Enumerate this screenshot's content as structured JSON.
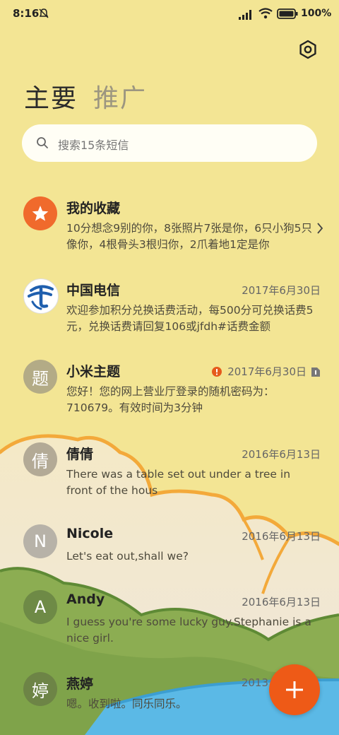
{
  "status_bar": {
    "time": "8:16",
    "battery": "100%"
  },
  "tabs": [
    {
      "label": "主要"
    },
    {
      "label": "推广"
    }
  ],
  "search": {
    "placeholder": "搜索15条短信"
  },
  "conversations": [
    {
      "name": "我的收藏",
      "date": "",
      "preview": "10分想念9别的你，8张照片7张是你，6只小狗5只像你，4根骨头3根归你，2爪着地1定是你",
      "avatar": "star-icon",
      "avatar_color": "#f06a2c"
    },
    {
      "name": "中国电信",
      "date": "2017年6月30日",
      "preview": "欢迎参加积分兑换话费活动，每500分可兑换话费5元，兑换话费请回复106或jfdh#话费金额",
      "avatar": "china-telecom-logo",
      "avatar_color": "#ffffff"
    },
    {
      "name": "小米主题",
      "date": "2017年6月30日",
      "preview": "您好！您的网上营业厅登录的随机密码为：710679。有效时间为3分钟",
      "avatar": "题",
      "avatar_color": "#b3ab86"
    },
    {
      "name": "倩倩",
      "date": "2016年6月13日",
      "preview": "There was a table set out under a tree in front of the hous",
      "avatar": "倩",
      "avatar_color": "#b3aa96"
    },
    {
      "name": "Nicole",
      "date": "2016年6月13日",
      "preview": "Let's eat out,shall we?",
      "avatar": "N",
      "avatar_color": "#b7b2a8"
    },
    {
      "name": "Andy",
      "date": "2016年6月13日",
      "preview": "I guess you're some lucky guy.Stephanie is a nice girl.",
      "avatar": "A",
      "avatar_color": "#6e8a46"
    },
    {
      "name": "燕婷",
      "date": "2013",
      "preview": "嗯。收到啦。同乐同乐。",
      "avatar": "婷",
      "avatar_color": "#6d8446"
    }
  ],
  "fab": {
    "icon": "plus-icon",
    "color": "#ee5a17"
  }
}
